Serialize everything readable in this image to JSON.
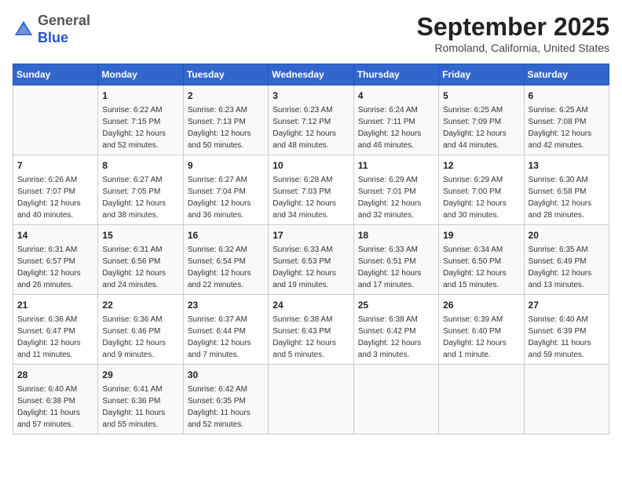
{
  "header": {
    "logo_general": "General",
    "logo_blue": "Blue",
    "month_title": "September 2025",
    "location": "Romoland, California, United States"
  },
  "calendar": {
    "days_of_week": [
      "Sunday",
      "Monday",
      "Tuesday",
      "Wednesday",
      "Thursday",
      "Friday",
      "Saturday"
    ],
    "weeks": [
      [
        {
          "day": "",
          "info": ""
        },
        {
          "day": "1",
          "info": "Sunrise: 6:22 AM\nSunset: 7:15 PM\nDaylight: 12 hours\nand 52 minutes."
        },
        {
          "day": "2",
          "info": "Sunrise: 6:23 AM\nSunset: 7:13 PM\nDaylight: 12 hours\nand 50 minutes."
        },
        {
          "day": "3",
          "info": "Sunrise: 6:23 AM\nSunset: 7:12 PM\nDaylight: 12 hours\nand 48 minutes."
        },
        {
          "day": "4",
          "info": "Sunrise: 6:24 AM\nSunset: 7:11 PM\nDaylight: 12 hours\nand 46 minutes."
        },
        {
          "day": "5",
          "info": "Sunrise: 6:25 AM\nSunset: 7:09 PM\nDaylight: 12 hours\nand 44 minutes."
        },
        {
          "day": "6",
          "info": "Sunrise: 6:25 AM\nSunset: 7:08 PM\nDaylight: 12 hours\nand 42 minutes."
        }
      ],
      [
        {
          "day": "7",
          "info": "Sunrise: 6:26 AM\nSunset: 7:07 PM\nDaylight: 12 hours\nand 40 minutes."
        },
        {
          "day": "8",
          "info": "Sunrise: 6:27 AM\nSunset: 7:05 PM\nDaylight: 12 hours\nand 38 minutes."
        },
        {
          "day": "9",
          "info": "Sunrise: 6:27 AM\nSunset: 7:04 PM\nDaylight: 12 hours\nand 36 minutes."
        },
        {
          "day": "10",
          "info": "Sunrise: 6:28 AM\nSunset: 7:03 PM\nDaylight: 12 hours\nand 34 minutes."
        },
        {
          "day": "11",
          "info": "Sunrise: 6:29 AM\nSunset: 7:01 PM\nDaylight: 12 hours\nand 32 minutes."
        },
        {
          "day": "12",
          "info": "Sunrise: 6:29 AM\nSunset: 7:00 PM\nDaylight: 12 hours\nand 30 minutes."
        },
        {
          "day": "13",
          "info": "Sunrise: 6:30 AM\nSunset: 6:58 PM\nDaylight: 12 hours\nand 28 minutes."
        }
      ],
      [
        {
          "day": "14",
          "info": "Sunrise: 6:31 AM\nSunset: 6:57 PM\nDaylight: 12 hours\nand 26 minutes."
        },
        {
          "day": "15",
          "info": "Sunrise: 6:31 AM\nSunset: 6:56 PM\nDaylight: 12 hours\nand 24 minutes."
        },
        {
          "day": "16",
          "info": "Sunrise: 6:32 AM\nSunset: 6:54 PM\nDaylight: 12 hours\nand 22 minutes."
        },
        {
          "day": "17",
          "info": "Sunrise: 6:33 AM\nSunset: 6:53 PM\nDaylight: 12 hours\nand 19 minutes."
        },
        {
          "day": "18",
          "info": "Sunrise: 6:33 AM\nSunset: 6:51 PM\nDaylight: 12 hours\nand 17 minutes."
        },
        {
          "day": "19",
          "info": "Sunrise: 6:34 AM\nSunset: 6:50 PM\nDaylight: 12 hours\nand 15 minutes."
        },
        {
          "day": "20",
          "info": "Sunrise: 6:35 AM\nSunset: 6:49 PM\nDaylight: 12 hours\nand 13 minutes."
        }
      ],
      [
        {
          "day": "21",
          "info": "Sunrise: 6:36 AM\nSunset: 6:47 PM\nDaylight: 12 hours\nand 11 minutes."
        },
        {
          "day": "22",
          "info": "Sunrise: 6:36 AM\nSunset: 6:46 PM\nDaylight: 12 hours\nand 9 minutes."
        },
        {
          "day": "23",
          "info": "Sunrise: 6:37 AM\nSunset: 6:44 PM\nDaylight: 12 hours\nand 7 minutes."
        },
        {
          "day": "24",
          "info": "Sunrise: 6:38 AM\nSunset: 6:43 PM\nDaylight: 12 hours\nand 5 minutes."
        },
        {
          "day": "25",
          "info": "Sunrise: 6:38 AM\nSunset: 6:42 PM\nDaylight: 12 hours\nand 3 minutes."
        },
        {
          "day": "26",
          "info": "Sunrise: 6:39 AM\nSunset: 6:40 PM\nDaylight: 12 hours\nand 1 minute."
        },
        {
          "day": "27",
          "info": "Sunrise: 6:40 AM\nSunset: 6:39 PM\nDaylight: 11 hours\nand 59 minutes."
        }
      ],
      [
        {
          "day": "28",
          "info": "Sunrise: 6:40 AM\nSunset: 6:38 PM\nDaylight: 11 hours\nand 57 minutes."
        },
        {
          "day": "29",
          "info": "Sunrise: 6:41 AM\nSunset: 6:36 PM\nDaylight: 11 hours\nand 55 minutes."
        },
        {
          "day": "30",
          "info": "Sunrise: 6:42 AM\nSunset: 6:35 PM\nDaylight: 11 hours\nand 52 minutes."
        },
        {
          "day": "",
          "info": ""
        },
        {
          "day": "",
          "info": ""
        },
        {
          "day": "",
          "info": ""
        },
        {
          "day": "",
          "info": ""
        }
      ]
    ]
  }
}
